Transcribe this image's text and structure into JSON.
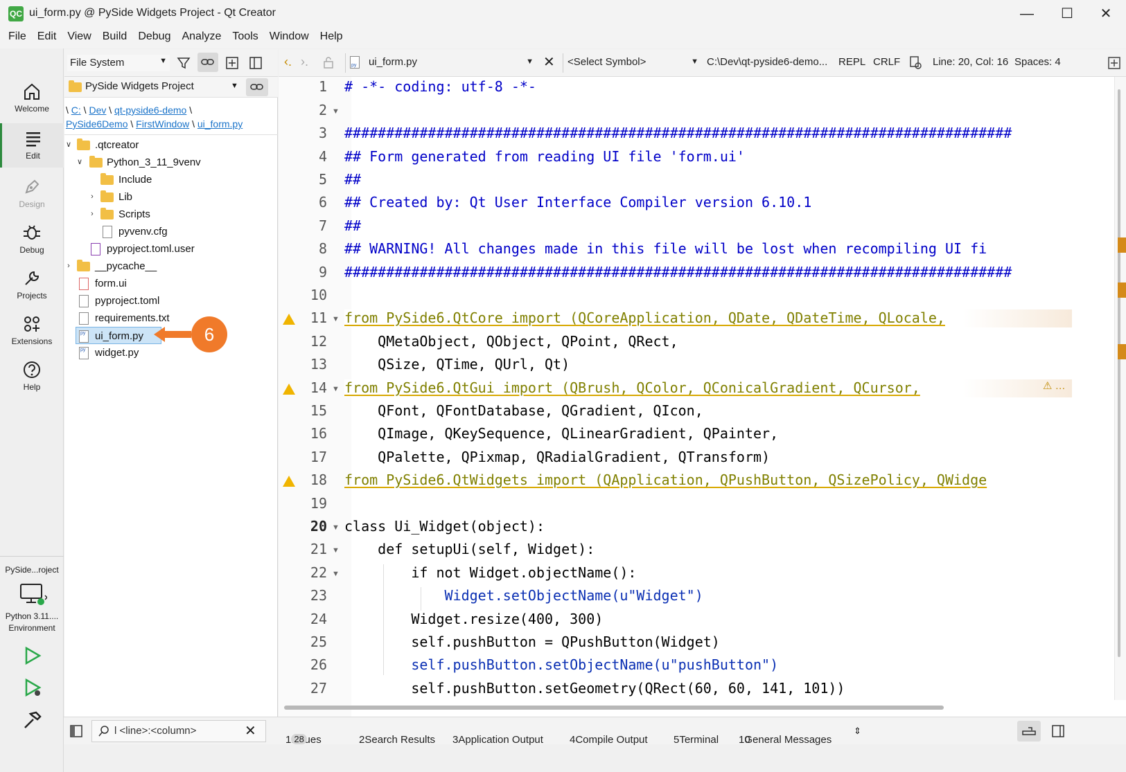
{
  "window": {
    "title": "ui_form.py @ PySide Widgets Project - Qt Creator",
    "app_icon": "QC"
  },
  "menu": [
    "File",
    "Edit",
    "View",
    "Build",
    "Debug",
    "Analyze",
    "Tools",
    "Window",
    "Help"
  ],
  "modes": [
    {
      "label": "Welcome",
      "icon": "home-icon"
    },
    {
      "label": "Edit",
      "icon": "edit-icon"
    },
    {
      "label": "Design",
      "icon": "pen-icon"
    },
    {
      "label": "Debug",
      "icon": "bug-icon"
    },
    {
      "label": "Projects",
      "icon": "wrench-icon"
    },
    {
      "label": "Extensions",
      "icon": "extensions-icon"
    },
    {
      "label": "Help",
      "icon": "help-icon"
    }
  ],
  "kit": {
    "project": "PySide...roject",
    "env_line1": "Python 3.11....",
    "env_line2": "Environment"
  },
  "file_system": {
    "combo": "File System",
    "project": "PySide Widgets Project",
    "breadcrumb": {
      "seg1": "C:",
      "seg2": "Dev",
      "seg3": "qt-pyside6-demo",
      "seg4": "PySide6Demo",
      "seg5": "FirstWindow",
      "seg6": "ui_form.py"
    },
    "tree": [
      ".qtcreator",
      "Python_3_11_9venv",
      "Include",
      "Lib",
      "Scripts",
      "pyvenv.cfg",
      "pyproject.toml.user",
      "__pycache__",
      "form.ui",
      "pyproject.toml",
      "requirements.txt",
      "ui_form.py",
      "widget.py"
    ]
  },
  "editor_toolbar": {
    "file": "ui_form.py",
    "symbol": "<Select Symbol>",
    "path": "C:\\Dev\\qt-pyside6-demo...",
    "repl": "REPL",
    "eol": "CRLF",
    "position": "Line: 20, Col: 16",
    "spaces": "Spaces: 4"
  },
  "code_lines": [
    "# -*- coding: utf-8 -*-",
    "",
    "################################################################################",
    "## Form generated from reading UI file 'form.ui'",
    "##",
    "## Created by: Qt User Interface Compiler version 6.10.1",
    "##",
    "## WARNING! All changes made in this file will be lost when recompiling UI fi",
    "################################################################################",
    "",
    "from PySide6.QtCore import (QCoreApplication, QDate, QDateTime, QLocale,",
    "    QMetaObject, QObject, QPoint, QRect,",
    "    QSize, QTime, QUrl, Qt)",
    "from PySide6.QtGui import (QBrush, QColor, QConicalGradient, QCursor,",
    "    QFont, QFontDatabase, QGradient, QIcon,",
    "    QImage, QKeySequence, QLinearGradient, QPainter,",
    "    QPalette, QPixmap, QRadialGradient, QTransform)",
    "from PySide6.QtWidgets import (QApplication, QPushButton, QSizePolicy, QWidge",
    "",
    "class Ui_Widget(object):",
    "    def setupUi(self, Widget):",
    "        if not Widget.objectName():",
    "            Widget.setObjectName(u\"Widget\")",
    "        Widget.resize(400, 300)",
    "        self.pushButton = QPushButton(Widget)",
    "        self.pushButton.setObjectName(u\"pushButton\")",
    "        self.pushButton.setGeometry(QRect(60, 60, 141, 101))"
  ],
  "line_numbers": [
    "1",
    "2",
    "3",
    "4",
    "5",
    "6",
    "7",
    "8",
    "9",
    "10",
    "11",
    "12",
    "13",
    "14",
    "15",
    "16",
    "17",
    "18",
    "19",
    "20",
    "21",
    "22",
    "23",
    "24",
    "25",
    "26",
    "27"
  ],
  "status_bar": {
    "locator_placeholder": "l <line>:<column>",
    "tabs": [
      {
        "num": "1",
        "label": "Issues",
        "badge": "28"
      },
      {
        "num": "2",
        "label": "Search Results"
      },
      {
        "num": "3",
        "label": "Application Output"
      },
      {
        "num": "4",
        "label": "Compile Output"
      },
      {
        "num": "5",
        "label": "Terminal"
      },
      {
        "num": "10",
        "label": "General Messages"
      }
    ]
  },
  "annotation": {
    "step": "6"
  },
  "colors": {
    "accent": "#2d8a3e",
    "callout": "#f07a2a",
    "warning": "#f0b400",
    "selection": "#cce4f7"
  }
}
